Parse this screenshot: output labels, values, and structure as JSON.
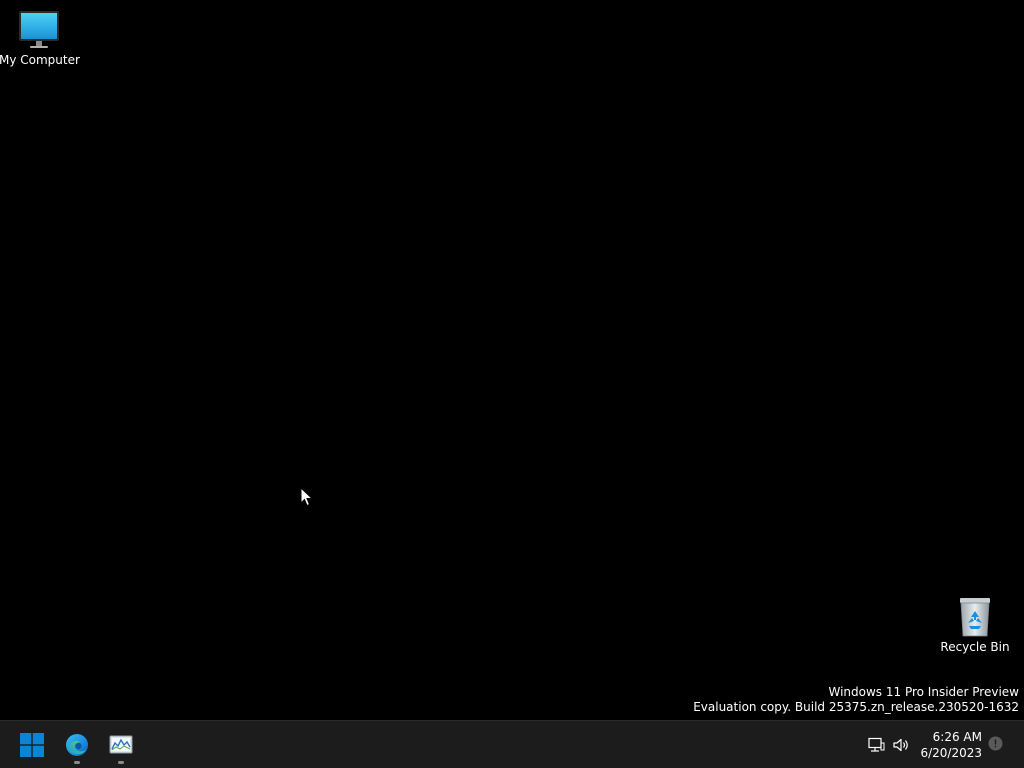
{
  "desktop": {
    "icons": [
      {
        "id": "computer",
        "label": "My Computer",
        "icon": "monitor-icon"
      },
      {
        "id": "recycle",
        "label": "Recycle Bin",
        "icon": "recycle-bin-icon"
      }
    ],
    "watermark": {
      "line1": "Windows 11 Pro Insider Preview",
      "line2": "Evaluation copy. Build 25375.zn_release.230520-1632"
    }
  },
  "taskbar": {
    "pinned": [
      {
        "name": "start",
        "icon": "windows-logo-icon"
      },
      {
        "name": "edge",
        "icon": "edge-browser-icon",
        "running": true
      },
      {
        "name": "performance-monitor",
        "icon": "performance-monitor-icon",
        "running": true
      }
    ],
    "tray": {
      "icons": [
        "network-icon",
        "volume-icon"
      ],
      "time": "6:26 AM",
      "date": "6/20/2023",
      "notification_icon": "notification-icon"
    }
  },
  "colors": {
    "desktop_bg": "#000000",
    "taskbar_bg": "#1c1c1c",
    "windows_blue": "#0a84d6"
  }
}
